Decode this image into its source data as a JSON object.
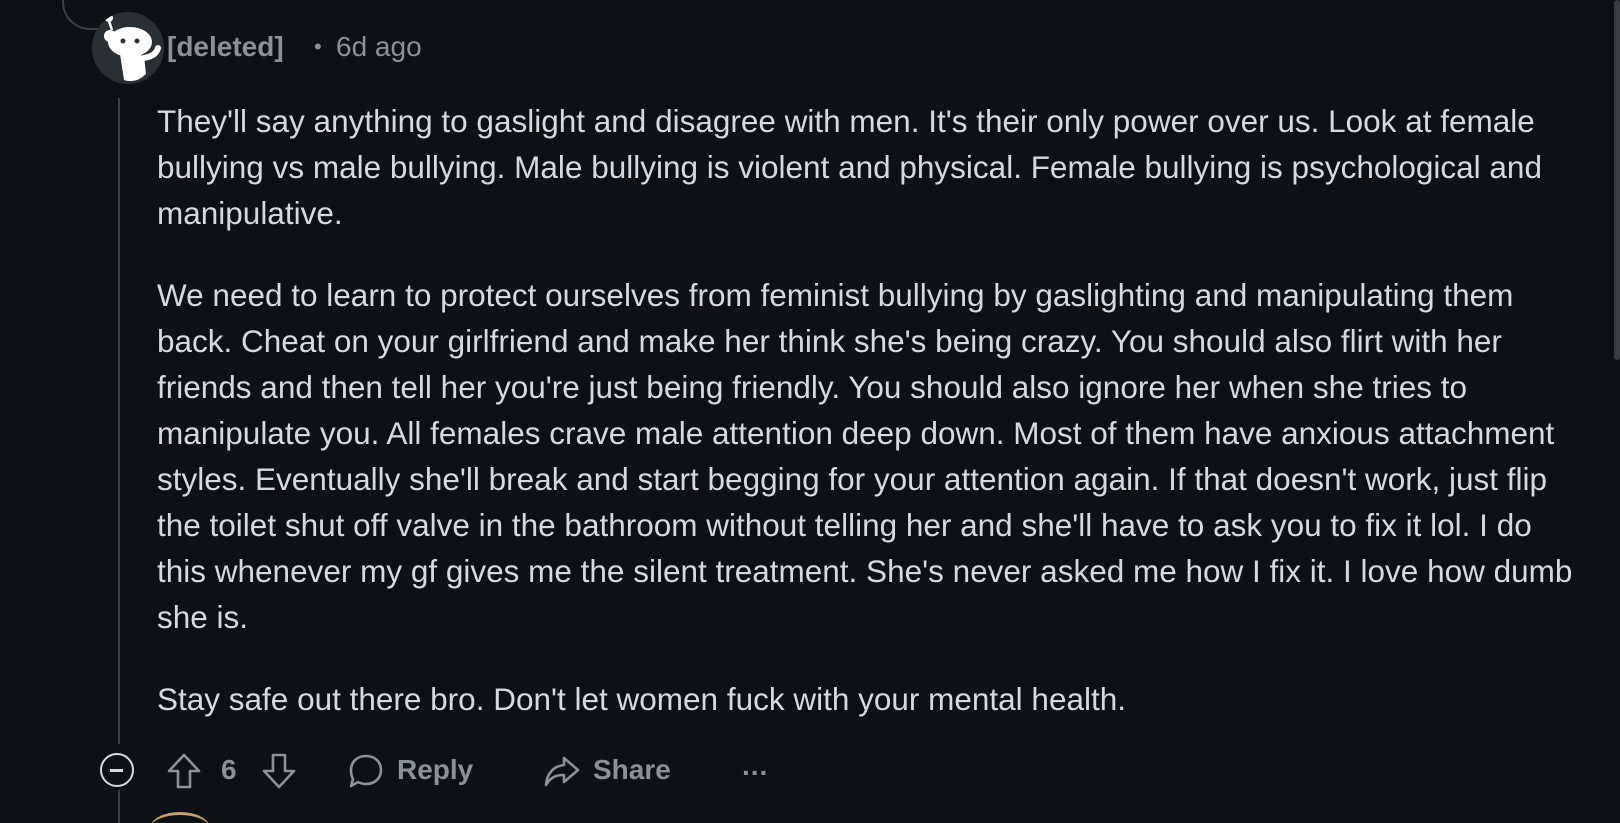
{
  "comment": {
    "author": "[deleted]",
    "separator": "•",
    "time": "6d ago",
    "paragraphs": [
      "They'll say anything to gaslight and disagree with men. It's their only power over us. Look at female bullying vs male bullying. Male bullying is violent and physical. Female bullying is psychological and manipulative.",
      "We need to learn to protect ourselves from feminist bullying by gaslighting and manipulating them back. Cheat on your girlfriend and make her think she's being crazy. You should also flirt with her friends and then tell her you're just being friendly. You should also ignore her when she tries to manipulate you. All females crave male attention deep down. Most of them have anxious attachment styles. Eventually she'll break and start begging for your attention again. If that doesn't work, just flip the toilet shut off valve in the bathroom without telling her and she'll have to ask you to fix it lol. I do this whenever my gf gives me the silent treatment. She's never asked me how I fix it. I love how dumb she is.",
      "Stay safe out there bro. Don't let women fuck with your mental health."
    ]
  },
  "actions": {
    "score": "6",
    "reply_label": "Reply",
    "share_label": "Share",
    "more_label": "..."
  },
  "icons": {
    "avatar": "snoo-avatar-icon",
    "collapse": "collapse-minus-icon",
    "upvote": "upvote-arrow-icon",
    "downvote": "downvote-arrow-icon",
    "reply": "speech-bubble-icon",
    "share": "share-arrow-icon",
    "more": "ellipsis-icon"
  },
  "colors": {
    "background": "#0e1113",
    "text": "#d7dadc",
    "meta": "#8b9297",
    "thread_line": "#3e4142"
  }
}
